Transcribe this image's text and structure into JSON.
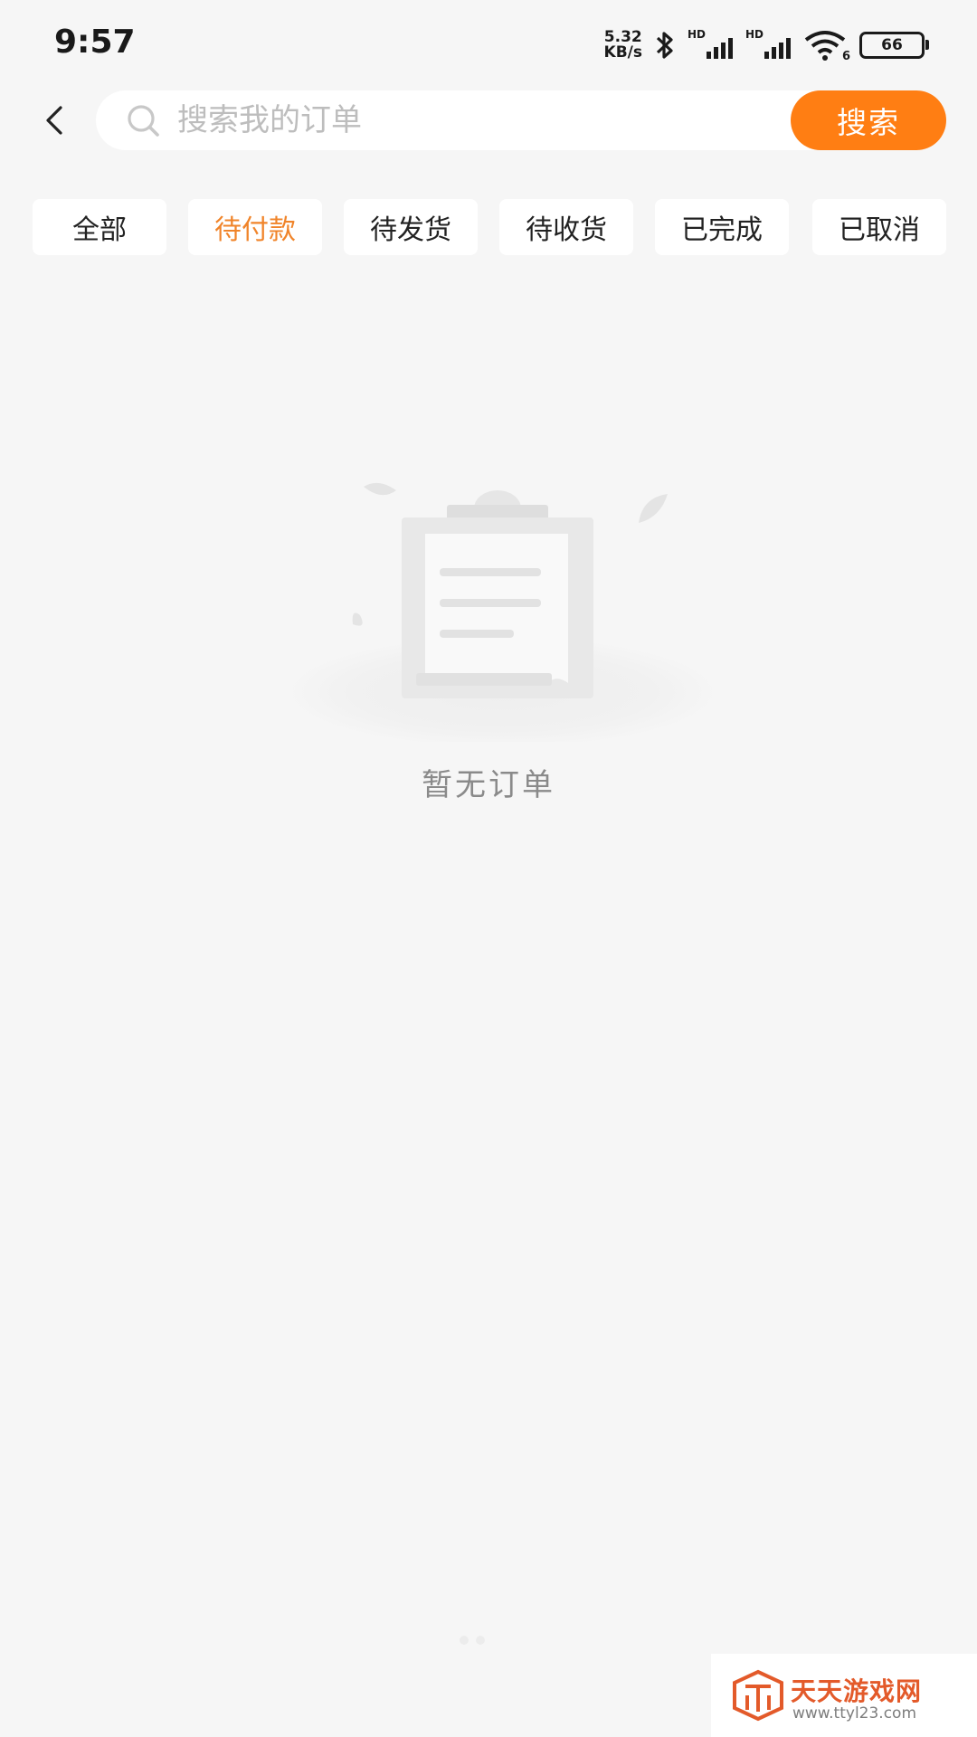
{
  "status_bar": {
    "time": "9:57",
    "net_speed_value": "5.32",
    "net_speed_unit": "KB/s",
    "sim1_label": "HD",
    "sim2_label": "HD",
    "wifi_label": "6",
    "battery": "66"
  },
  "header": {
    "search_placeholder": "搜索我的订单",
    "search_button": "搜索"
  },
  "tabs": [
    {
      "label": "全部",
      "active": false
    },
    {
      "label": "待付款",
      "active": true
    },
    {
      "label": "待发货",
      "active": false
    },
    {
      "label": "待收货",
      "active": false
    },
    {
      "label": "已完成",
      "active": false
    },
    {
      "label": "已取消",
      "active": false
    }
  ],
  "empty_state": {
    "message": "暂无订单"
  },
  "watermark": {
    "title": "天天游戏网",
    "url": "www.ttyl23.com"
  },
  "colors": {
    "accent": "#ff7e13",
    "active_tab": "#f0842a",
    "background": "#f6f6f6"
  }
}
